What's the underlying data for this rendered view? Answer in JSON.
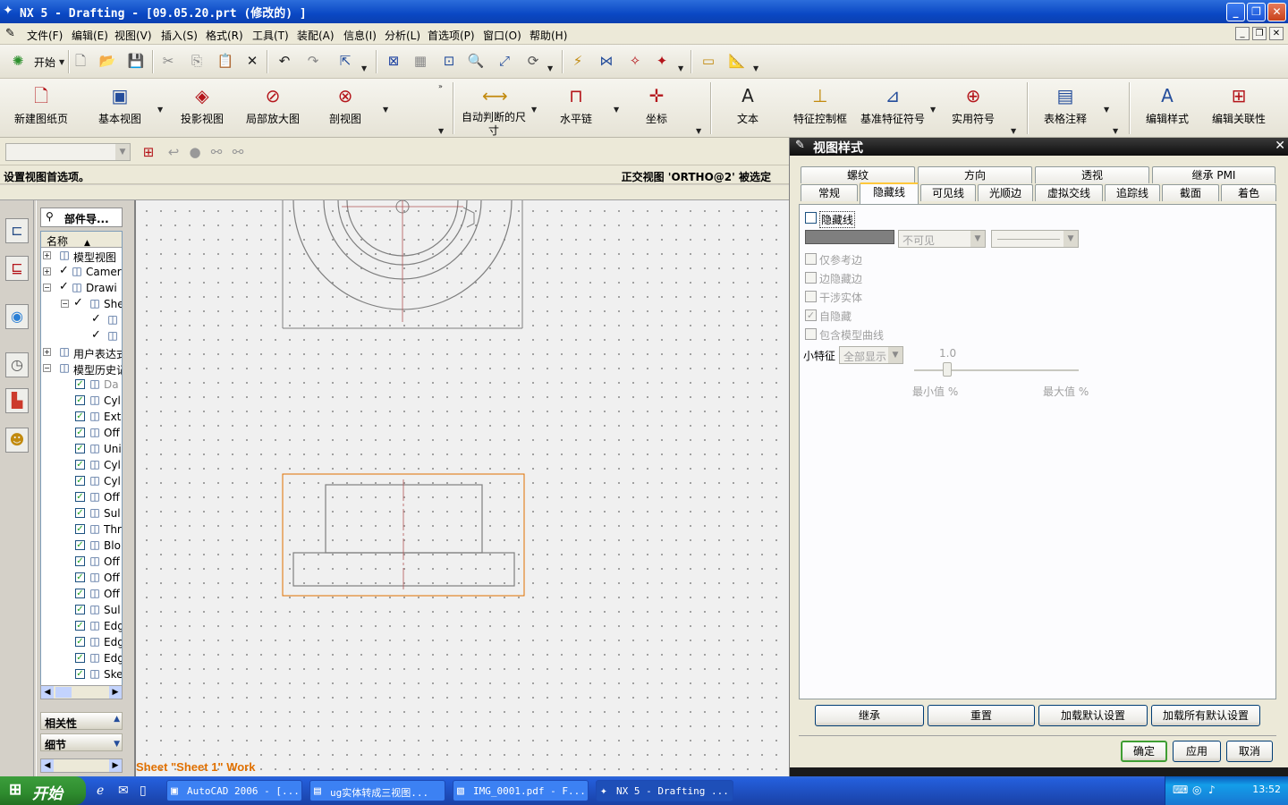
{
  "window": {
    "title": "NX 5 - Drafting - [09.05.20.prt  (修改的) ]"
  },
  "menu": [
    "文件(F)",
    "编辑(E)",
    "视图(V)",
    "插入(S)",
    "格式(R)",
    "工具(T)",
    "装配(A)",
    "信息(I)",
    "分析(L)",
    "首选项(P)",
    "窗口(O)",
    "帮助(H)"
  ],
  "toolbar1": {
    "start_label": "开始"
  },
  "toolbar2": [
    "新建图纸页",
    "基本视图",
    "投影视图",
    "局部放大图",
    "剖视图",
    "自动判断的尺寸",
    "水平链",
    "坐标",
    "文本",
    "特征控制框",
    "基准特征符号",
    "实用符号",
    "表格注释",
    "编辑样式",
    "编辑关联性"
  ],
  "status": {
    "cue": "设置视图首选项。",
    "selection": "正交视图 'ORTHO@2' 被选定"
  },
  "navigator": {
    "title": "部件导...",
    "column": "名称",
    "items": [
      {
        "label": "模型视图",
        "icon": "views-icon"
      },
      {
        "label": "Camer",
        "icon": "camera-icon"
      },
      {
        "label": "Drawi",
        "icon": "drawing-icon"
      },
      {
        "label": "She",
        "icon": "sheet-icon"
      },
      {
        "label": "",
        "icon": "view-icon"
      },
      {
        "label": "",
        "icon": "view-icon"
      },
      {
        "label": "用户表达式",
        "icon": "folder-icon"
      },
      {
        "label": "模型历史记",
        "icon": "folder-icon"
      },
      {
        "label": "Da",
        "icon": "datum-icon"
      },
      {
        "label": "Cyl",
        "icon": "cylinder-icon"
      },
      {
        "label": "Ext",
        "icon": "extrude-icon"
      },
      {
        "label": "Off",
        "icon": "offset-icon"
      },
      {
        "label": "Uni",
        "icon": "unite-icon"
      },
      {
        "label": "Cyl",
        "icon": "cylinder-icon"
      },
      {
        "label": "Cyl",
        "icon": "cylinder-icon"
      },
      {
        "label": "Off",
        "icon": "offset-icon"
      },
      {
        "label": "Sul",
        "icon": "subtract-icon"
      },
      {
        "label": "Thr",
        "icon": "thread-icon"
      },
      {
        "label": "Blo",
        "icon": "block-icon"
      },
      {
        "label": "Off",
        "icon": "offset-icon"
      },
      {
        "label": "Off",
        "icon": "offset-icon"
      },
      {
        "label": "Off",
        "icon": "offset-icon"
      },
      {
        "label": "Sul",
        "icon": "subtract-icon"
      },
      {
        "label": "Edg",
        "icon": "edge-blend-icon"
      },
      {
        "label": "Edg",
        "icon": "edge-blend-icon"
      },
      {
        "label": "Edg",
        "icon": "edge-blend-icon"
      },
      {
        "label": "Ske",
        "icon": "sketch-icon"
      }
    ],
    "panels": [
      "相关性",
      "细节"
    ]
  },
  "canvas": {
    "sheet_label": "Sheet \"Sheet 1\" Work"
  },
  "dialog": {
    "title": "视图样式",
    "tabs_row1": [
      "螺纹",
      "方向",
      "透视",
      "继承 PMI"
    ],
    "tabs_row2": [
      "常规",
      "隐藏线",
      "可见线",
      "光顺边",
      "虚拟交线",
      "追踪线",
      "截面",
      "着色"
    ],
    "active_tab": "隐藏线",
    "hidden_lines_label": "隐藏线",
    "line_font": "不可见",
    "options": [
      {
        "label": "仅参考边",
        "checked": false
      },
      {
        "label": "边隐藏边",
        "checked": false
      },
      {
        "label": "干涉实体",
        "checked": false
      },
      {
        "label": "自隐藏",
        "checked": true
      },
      {
        "label": "包含模型曲线",
        "checked": false
      }
    ],
    "small_feature_label": "小特征",
    "small_feature_value": "全部显示",
    "slider_value": "1.0",
    "slider_min_label": "最小值 %",
    "slider_max_label": "最大值 %",
    "buttons": [
      "继承",
      "重置",
      "加载默认设置",
      "加载所有默认设置"
    ],
    "ok": "确定",
    "apply": "应用",
    "cancel": "取消"
  },
  "taskbar": {
    "start": "开始",
    "tasks": [
      "AutoCAD 2006 - [...",
      "ug实体转成三视图...",
      "IMG_0001.pdf - F...",
      "NX 5 - Drafting ..."
    ],
    "clock": "13:52"
  },
  "colors": {
    "title_blue": "#0a48c4",
    "selection_orange": "#e07000",
    "ok_green": "#3f9e33"
  }
}
